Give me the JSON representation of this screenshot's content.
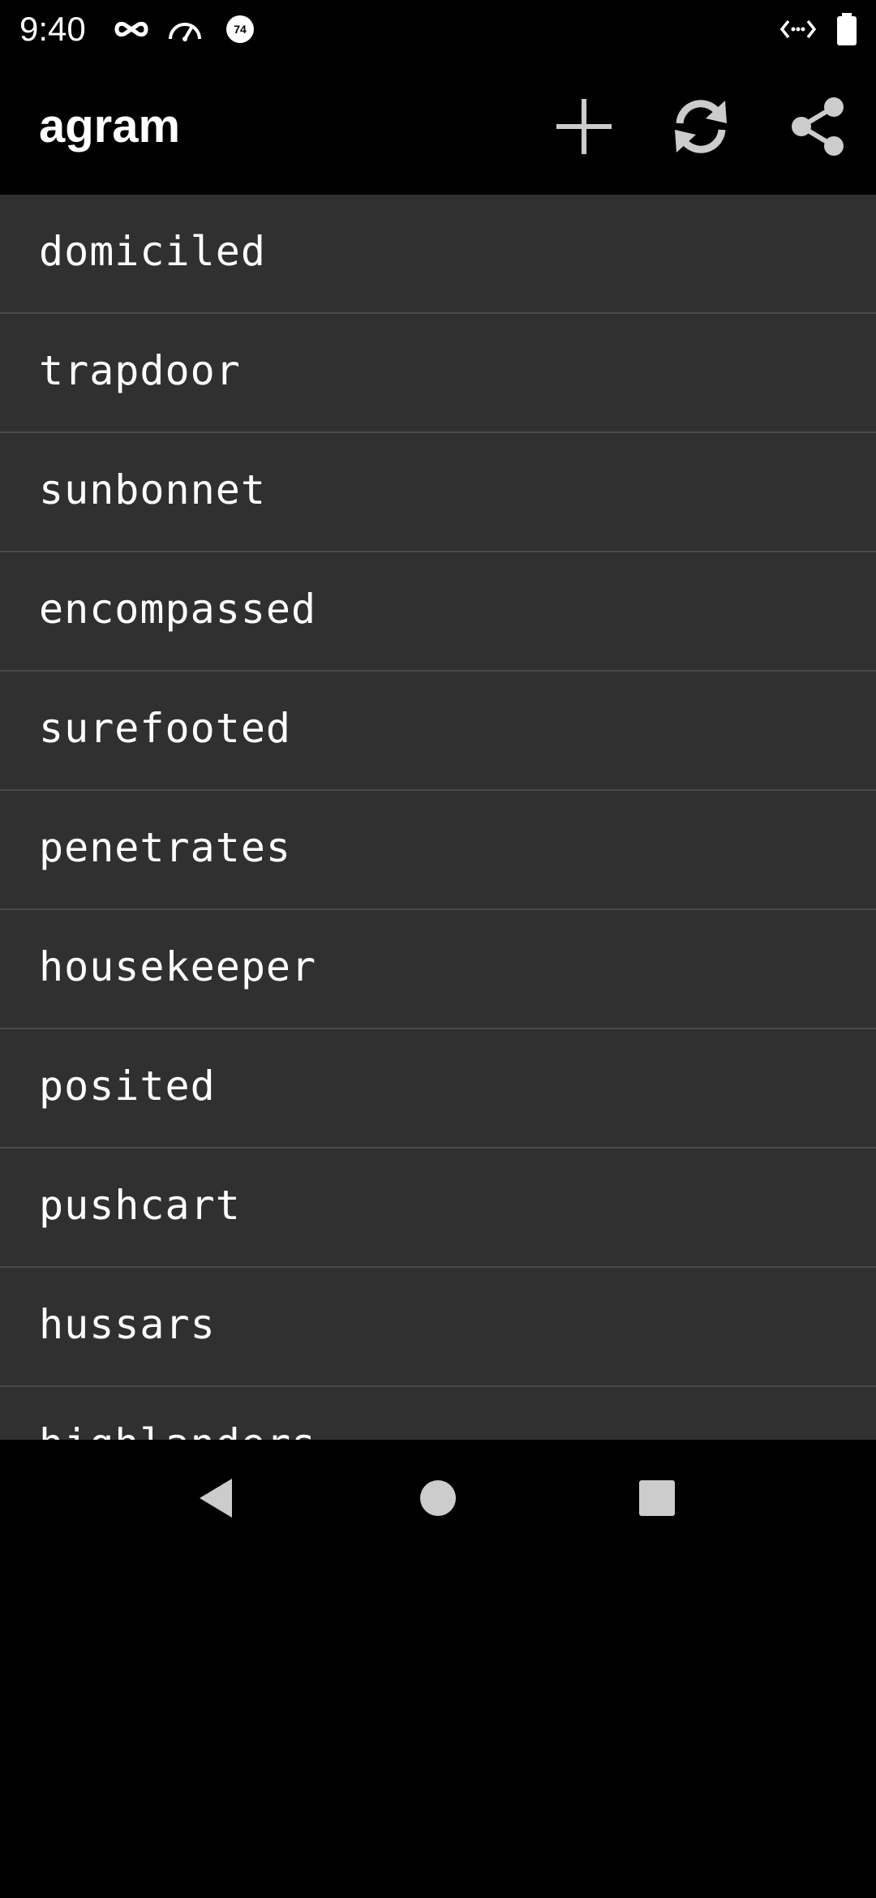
{
  "status_bar": {
    "time": "9:40",
    "icons": [
      "incognito-icon",
      "speedometer-icon",
      "notification-74-icon",
      "data-transfer-icon",
      "battery-icon"
    ],
    "badge_value": "74"
  },
  "app_bar": {
    "title": "agram",
    "actions": [
      "add-icon",
      "refresh-icon",
      "share-icon"
    ]
  },
  "list": {
    "items": [
      {
        "label": "domiciled"
      },
      {
        "label": "trapdoor"
      },
      {
        "label": "sunbonnet"
      },
      {
        "label": "encompassed"
      },
      {
        "label": "surefooted"
      },
      {
        "label": "penetrates"
      },
      {
        "label": "housekeeper"
      },
      {
        "label": "posited"
      },
      {
        "label": "pushcart"
      },
      {
        "label": "hussars"
      },
      {
        "label": "highlanders"
      }
    ]
  },
  "nav_bar": {
    "buttons": [
      "back-icon",
      "home-icon",
      "recents-icon"
    ]
  },
  "colors": {
    "background": "#000000",
    "list_background": "#303030",
    "divider": "#4a4a4a",
    "icon": "#cccccc",
    "text": "#ffffff"
  }
}
